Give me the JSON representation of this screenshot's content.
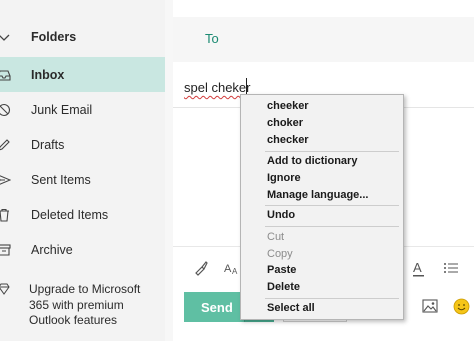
{
  "sidebar": {
    "folders_label": "Folders",
    "items": [
      {
        "label": "Inbox",
        "icon": "inbox-icon",
        "active": true
      },
      {
        "label": "Junk Email",
        "icon": "junk-icon"
      },
      {
        "label": "Drafts",
        "icon": "pencil-icon"
      },
      {
        "label": "Sent Items",
        "icon": "send-icon"
      },
      {
        "label": "Deleted Items",
        "icon": "trash-icon"
      },
      {
        "label": "Archive",
        "icon": "archive-icon"
      }
    ],
    "upgrade_text": "Upgrade to Microsoft 365 with premium Outlook features"
  },
  "compose": {
    "to_label": "To",
    "subject_value": "spel cheker",
    "send_label": "Send"
  },
  "context_menu": {
    "suggestions": [
      "cheeker",
      "choker",
      "checker"
    ],
    "add_to_dictionary": "Add to dictionary",
    "ignore": "Ignore",
    "manage_language": "Manage language...",
    "undo": "Undo",
    "cut": "Cut",
    "copy": "Copy",
    "paste": "Paste",
    "delete": "Delete",
    "select_all": "Select all"
  },
  "colors": {
    "accent": "#5fbfa3",
    "active_folder_bg": "#c9e7e1",
    "to_label": "#1b8a72",
    "spellcheck_underline": "#d23c3c"
  }
}
